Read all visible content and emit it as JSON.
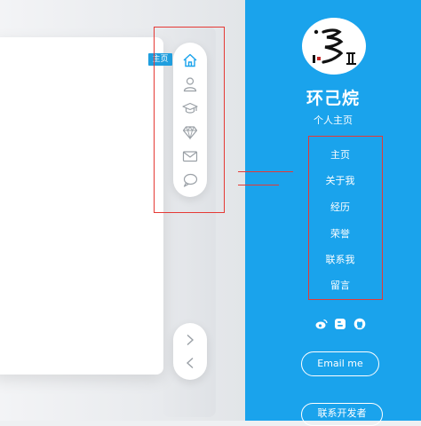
{
  "nav": {
    "tooltip": "主页",
    "items": [
      {
        "icon": "home-icon",
        "active": true
      },
      {
        "icon": "user-icon",
        "active": false
      },
      {
        "icon": "graduation-cap-icon",
        "active": false
      },
      {
        "icon": "diamond-icon",
        "active": false
      },
      {
        "icon": "mail-icon",
        "active": false
      },
      {
        "icon": "chat-bubble-icon",
        "active": false
      }
    ],
    "arrows": [
      {
        "icon": "chevron-right-icon"
      },
      {
        "icon": "chevron-left-icon"
      }
    ]
  },
  "sidebar": {
    "name": "环己烷",
    "subtitle": "个人主页",
    "menu": [
      {
        "label": "主页"
      },
      {
        "label": "关于我"
      },
      {
        "label": "经历"
      },
      {
        "label": "荣誉"
      },
      {
        "label": "联系我"
      },
      {
        "label": "留言"
      }
    ],
    "social": [
      {
        "icon": "weibo-icon"
      },
      {
        "icon": "blogger-icon"
      },
      {
        "icon": "github-icon"
      }
    ],
    "email_button": "Email me",
    "contact_button": "联系开发者"
  },
  "colors": {
    "sidebar_bg": "#1aa3ec",
    "accent": "#1f9ede",
    "highlight_box": "#e53935",
    "icon_gray": "#9aa0a6"
  }
}
